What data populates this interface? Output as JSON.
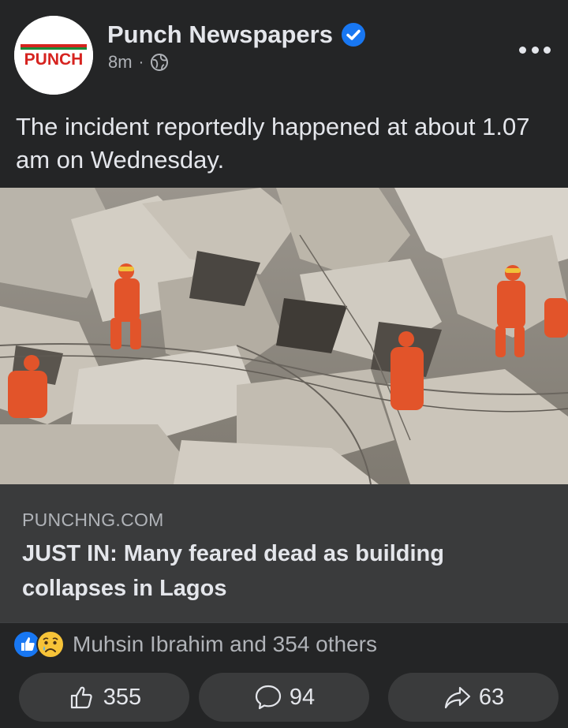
{
  "post": {
    "page_name": "Punch Newspapers",
    "logo_text": "PUNCH",
    "time": "8m",
    "separator": "·",
    "caption": "The incident reportedly happened at about 1.07 am on Wednesday.",
    "link": {
      "domain": "PUNCHNG.COM",
      "headline": "JUST IN: Many feared dead as building collapses in Lagos"
    },
    "reactions": {
      "summary": "Muhsin Ibrahim and 354 others",
      "icons": [
        "like-icon",
        "sad-icon"
      ]
    },
    "actions": {
      "likes": "355",
      "comments": "94",
      "shares": "63"
    }
  },
  "colors": {
    "background": "#242526",
    "link_box": "#3a3b3c",
    "verified": "#1877f2",
    "logo_red": "#d6231f",
    "logo_green": "#1b8b3a",
    "rescue_orange": "#e2542a"
  }
}
